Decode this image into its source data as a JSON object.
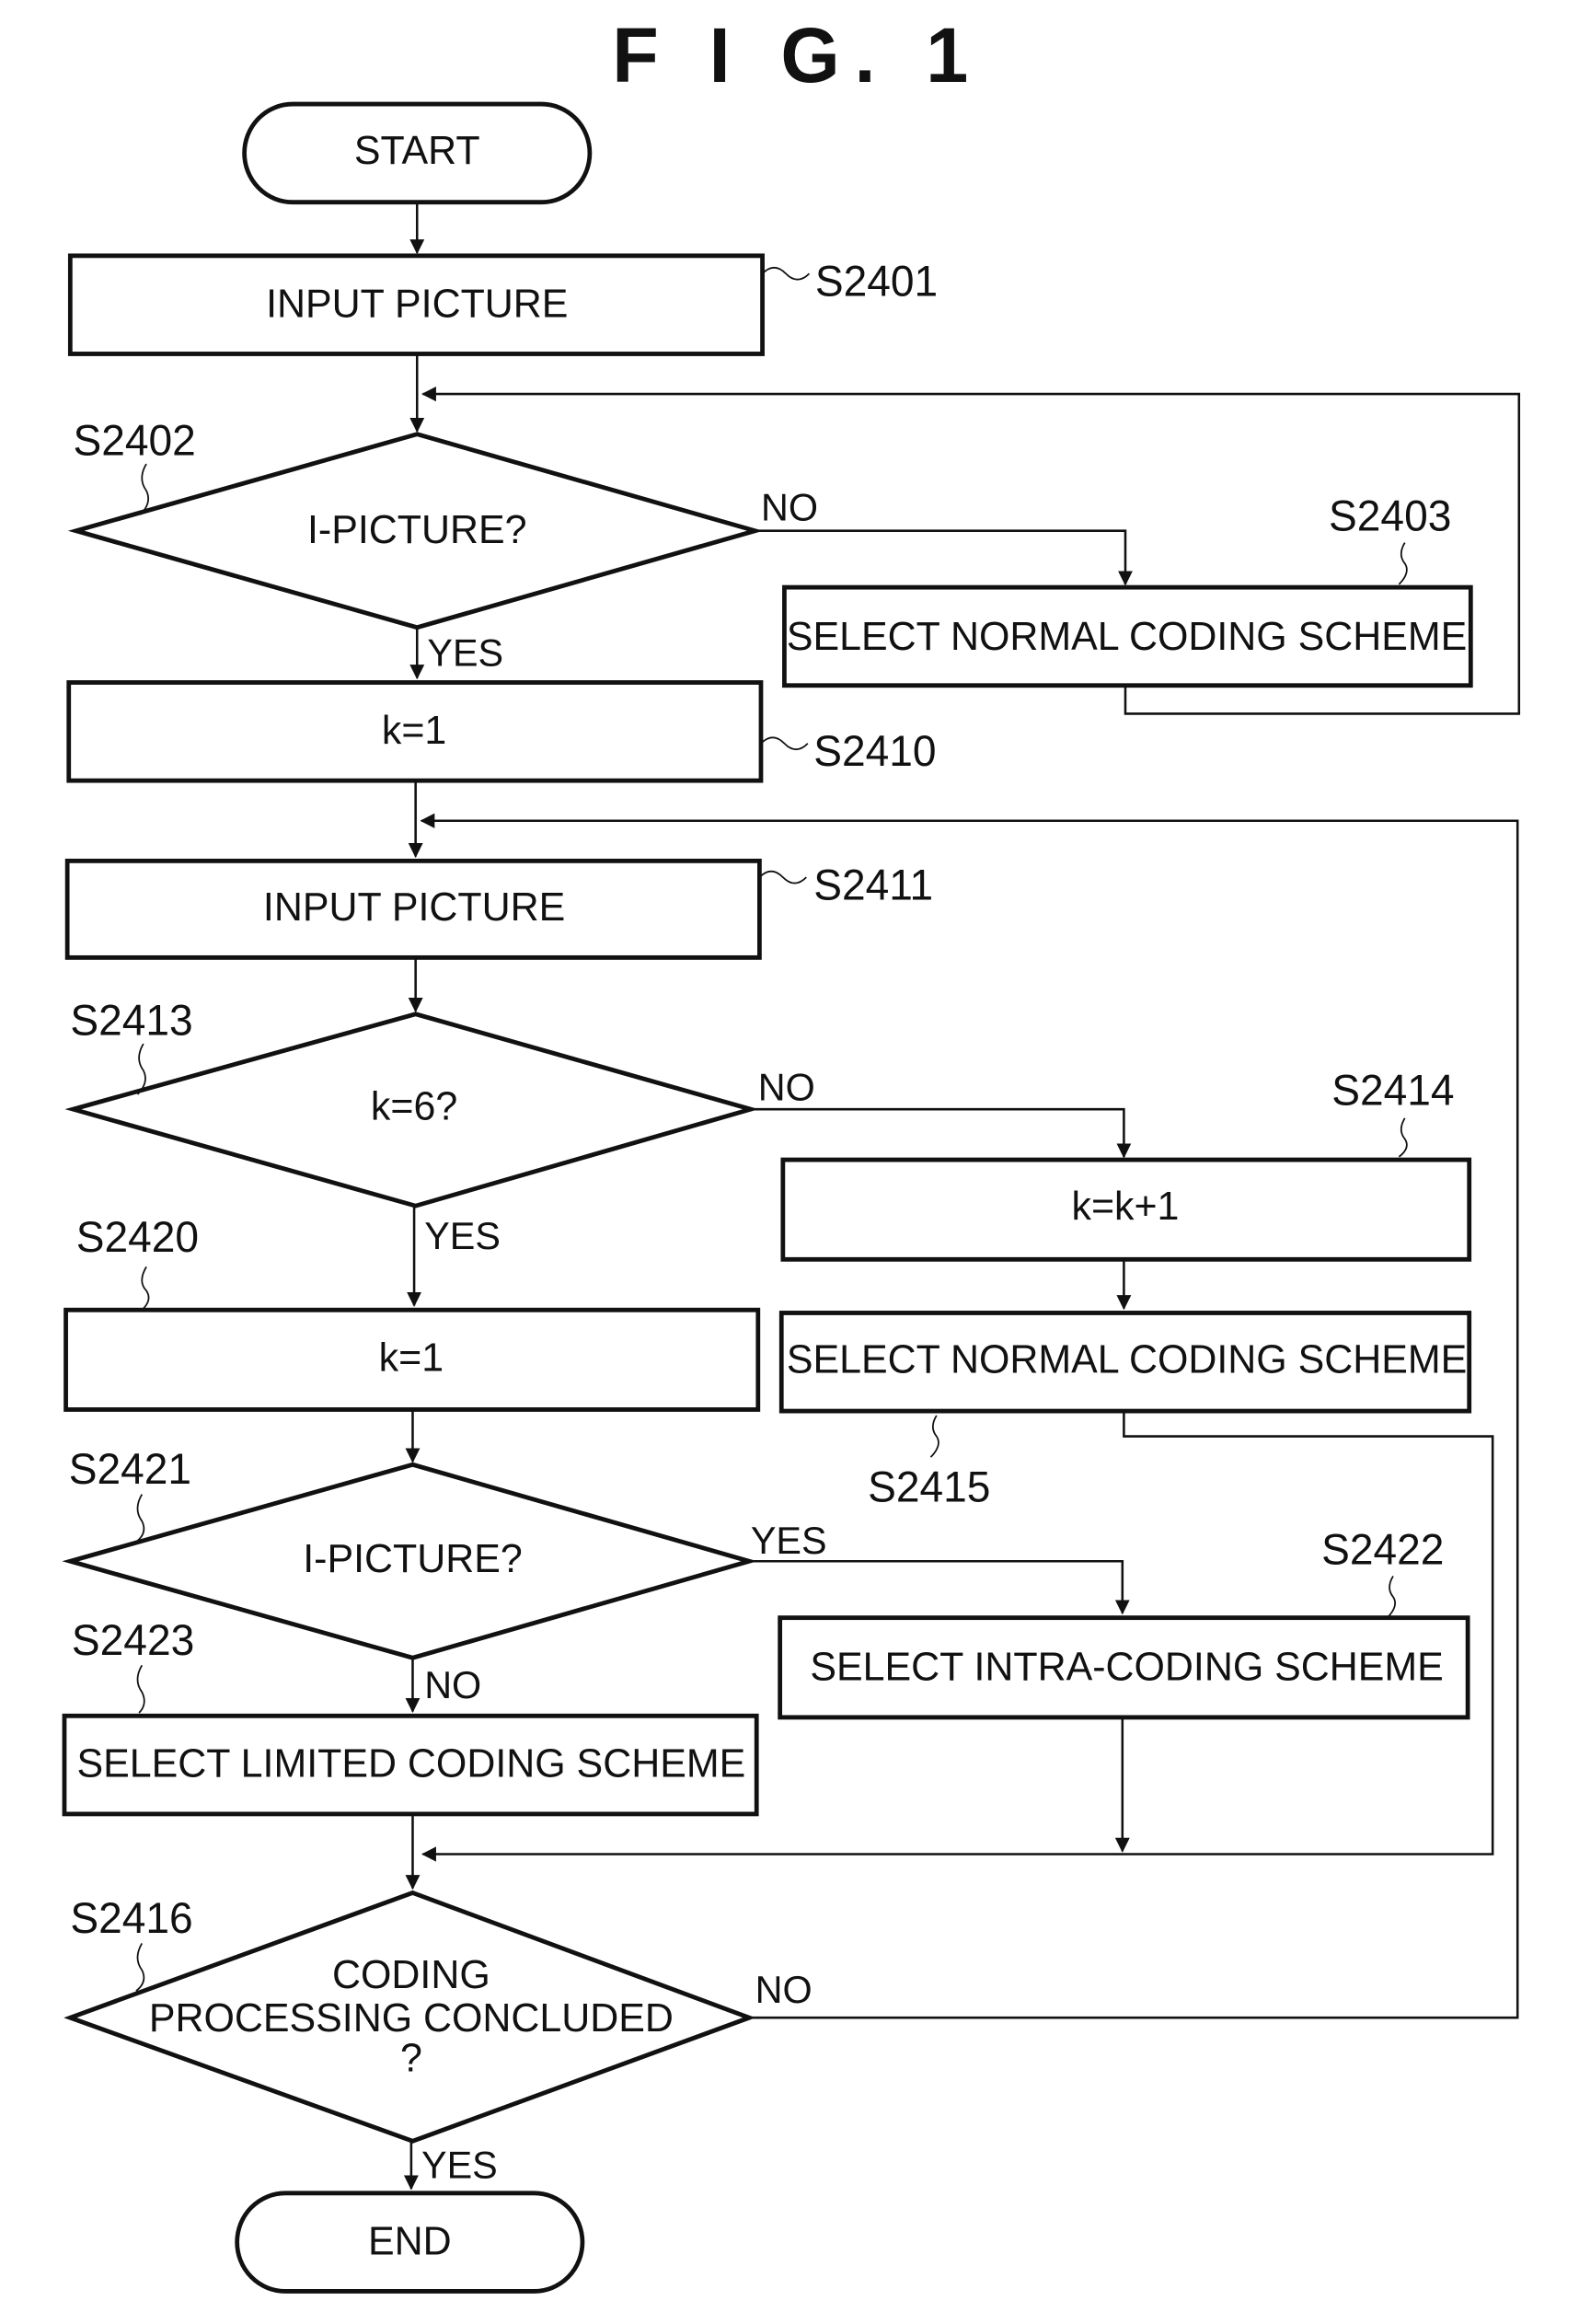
{
  "figure": {
    "title": "F I G. 1",
    "nodes": {
      "start": {
        "text": "START"
      },
      "s2401": {
        "text": "INPUT PICTURE",
        "label": "S2401"
      },
      "s2402": {
        "text": "I-PICTURE?",
        "label": "S2402",
        "yes": "YES",
        "no": "NO"
      },
      "s2403": {
        "text": "SELECT NORMAL CODING SCHEME",
        "label": "S2403"
      },
      "s2410": {
        "text": "k=1",
        "label": "S2410"
      },
      "s2411": {
        "text": "INPUT PICTURE",
        "label": "S2411"
      },
      "s2413": {
        "text": "k=6?",
        "label": "S2413",
        "yes": "YES",
        "no": "NO"
      },
      "s2414": {
        "text": "k=k+1",
        "label": "S2414"
      },
      "s2415": {
        "text": "SELECT NORMAL CODING SCHEME",
        "label": "S2415"
      },
      "s2420": {
        "text": "k=1",
        "label": "S2420"
      },
      "s2421": {
        "text": "I-PICTURE?",
        "label": "S2421",
        "yes": "YES",
        "no": "NO"
      },
      "s2422": {
        "text": "SELECT INTRA-CODING SCHEME",
        "label": "S2422"
      },
      "s2423": {
        "text": "SELECT LIMITED CODING SCHEME",
        "label": "S2423"
      },
      "s2416": {
        "lines": [
          "CODING",
          "PROCESSING CONCLUDED",
          "?"
        ],
        "label": "S2416",
        "yes": "YES",
        "no": "NO"
      },
      "end": {
        "text": "END"
      }
    }
  }
}
